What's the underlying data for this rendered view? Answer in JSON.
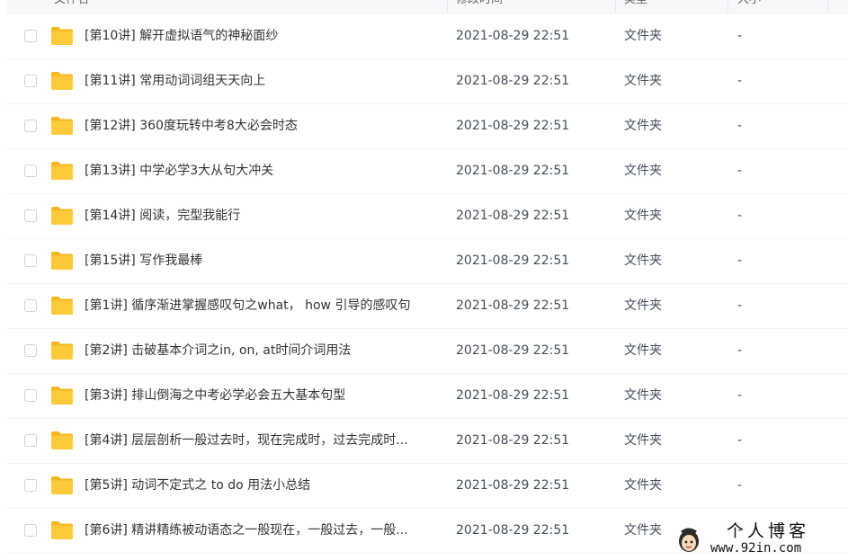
{
  "header": {
    "name_label": "文件名",
    "modified_label": "修改时间",
    "type_label": "类型",
    "size_label": "大小"
  },
  "files": [
    {
      "name": "[第10讲] 解开虚拟语气的神秘面纱",
      "modified": "2021-08-29 22:51",
      "type": "文件夹",
      "size": "-"
    },
    {
      "name": "[第11讲] 常用动词词组天天向上",
      "modified": "2021-08-29 22:51",
      "type": "文件夹",
      "size": "-"
    },
    {
      "name": "[第12讲] 360度玩转中考8大必会时态",
      "modified": "2021-08-29 22:51",
      "type": "文件夹",
      "size": "-"
    },
    {
      "name": "[第13讲] 中学必学3大从句大冲关",
      "modified": "2021-08-29 22:51",
      "type": "文件夹",
      "size": "-"
    },
    {
      "name": "[第14讲] 阅读，完型我能行",
      "modified": "2021-08-29 22:51",
      "type": "文件夹",
      "size": "-"
    },
    {
      "name": "[第15讲] 写作我最棒",
      "modified": "2021-08-29 22:51",
      "type": "文件夹",
      "size": "-"
    },
    {
      "name": "[第1讲] 循序渐进掌握感叹句之what， how 引导的感叹句",
      "modified": "2021-08-29 22:51",
      "type": "文件夹",
      "size": "-"
    },
    {
      "name": "[第2讲] 击破基本介词之in, on, at时间介词用法",
      "modified": "2021-08-29 22:51",
      "type": "文件夹",
      "size": "-"
    },
    {
      "name": "[第3讲] 排山倒海之中考必学必会五大基本句型",
      "modified": "2021-08-29 22:51",
      "type": "文件夹",
      "size": "-"
    },
    {
      "name": "[第4讲] 层层剖析一般过去时，现在完成时，过去完成时...",
      "modified": "2021-08-29 22:51",
      "type": "文件夹",
      "size": "-"
    },
    {
      "name": "[第5讲] 动词不定式之 to do 用法小总结",
      "modified": "2021-08-29 22:51",
      "type": "文件夹",
      "size": "-"
    },
    {
      "name": "[第6讲] 精讲精练被动语态之一般现在，一般过去，一般...",
      "modified": "2021-08-29 22:51",
      "type": "文件夹",
      "size": "-"
    }
  ],
  "watermark": {
    "title": "个人博客",
    "url": "www.92in.com"
  },
  "icons": {
    "row_icon": "folder-icon",
    "sort_icon": "chevron-down-icon",
    "watermark_icon": "avatar-icon"
  },
  "colors": {
    "folder": "#ffc93c",
    "folder_dark": "#f5b71f",
    "text": "#333333",
    "meta_text": "#454d5a",
    "header_bg": "#f7f8fa"
  }
}
